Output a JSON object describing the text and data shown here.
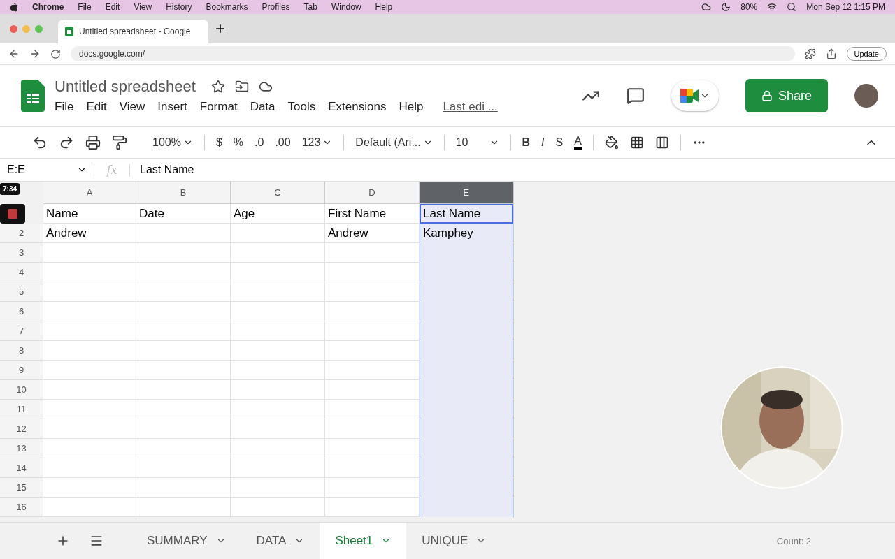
{
  "menubar": {
    "app": "Chrome",
    "menus": [
      "File",
      "Edit",
      "View",
      "History",
      "Bookmarks",
      "Profiles",
      "Tab",
      "Window",
      "Help"
    ],
    "battery": "80%",
    "clock": "Mon Sep 12  1:15 PM"
  },
  "browser": {
    "tab_title": "Untitled spreadsheet - Google",
    "url": "docs.google.com/",
    "update_button": "Update"
  },
  "doc": {
    "title": "Untitled spreadsheet",
    "menus": [
      "File",
      "Edit",
      "View",
      "Insert",
      "Format",
      "Data",
      "Tools",
      "Extensions",
      "Help"
    ],
    "last_edit": "Last edi ...",
    "share": "Share"
  },
  "toolbar": {
    "zoom": "100%",
    "currency": "$",
    "percent": "%",
    "decrease_decimals": ".0",
    "increase_decimals": ".00",
    "number_format": "123",
    "font": "Default (Ari...",
    "font_size": "10",
    "bold": "B",
    "italic": "I",
    "strike": "S",
    "text_color": "A"
  },
  "formula_bar": {
    "name_box": "E:E",
    "fx": "fx",
    "value": "Last Name"
  },
  "recorder": {
    "timer": "7:34"
  },
  "grid": {
    "columns": [
      {
        "label": "A",
        "selected": false
      },
      {
        "label": "B",
        "selected": false
      },
      {
        "label": "C",
        "selected": false
      },
      {
        "label": "D",
        "selected": false
      },
      {
        "label": "E",
        "selected": true
      }
    ],
    "rows": [
      {
        "cells": [
          "Name",
          "Date",
          "Age",
          "First Name",
          "Last Name"
        ]
      },
      {
        "number": "2",
        "cells": [
          "Andrew",
          null,
          null,
          "Andrew",
          "Kamphey"
        ]
      },
      {
        "number": "3"
      },
      {
        "number": "4"
      },
      {
        "number": "5"
      },
      {
        "number": "6"
      },
      {
        "number": "7"
      },
      {
        "number": "8"
      },
      {
        "number": "9"
      },
      {
        "number": "10"
      },
      {
        "number": "11"
      },
      {
        "number": "12"
      },
      {
        "number": "13"
      },
      {
        "number": "14"
      },
      {
        "number": "15"
      },
      {
        "number": "16"
      }
    ]
  },
  "sheet_tabs": [
    {
      "label": "SUMMARY",
      "selected": false
    },
    {
      "label": "DATA",
      "selected": false
    },
    {
      "label": "Sheet1",
      "selected": true
    },
    {
      "label": "UNIQUE",
      "selected": false
    }
  ],
  "status": {
    "count": "Count: 2"
  }
}
